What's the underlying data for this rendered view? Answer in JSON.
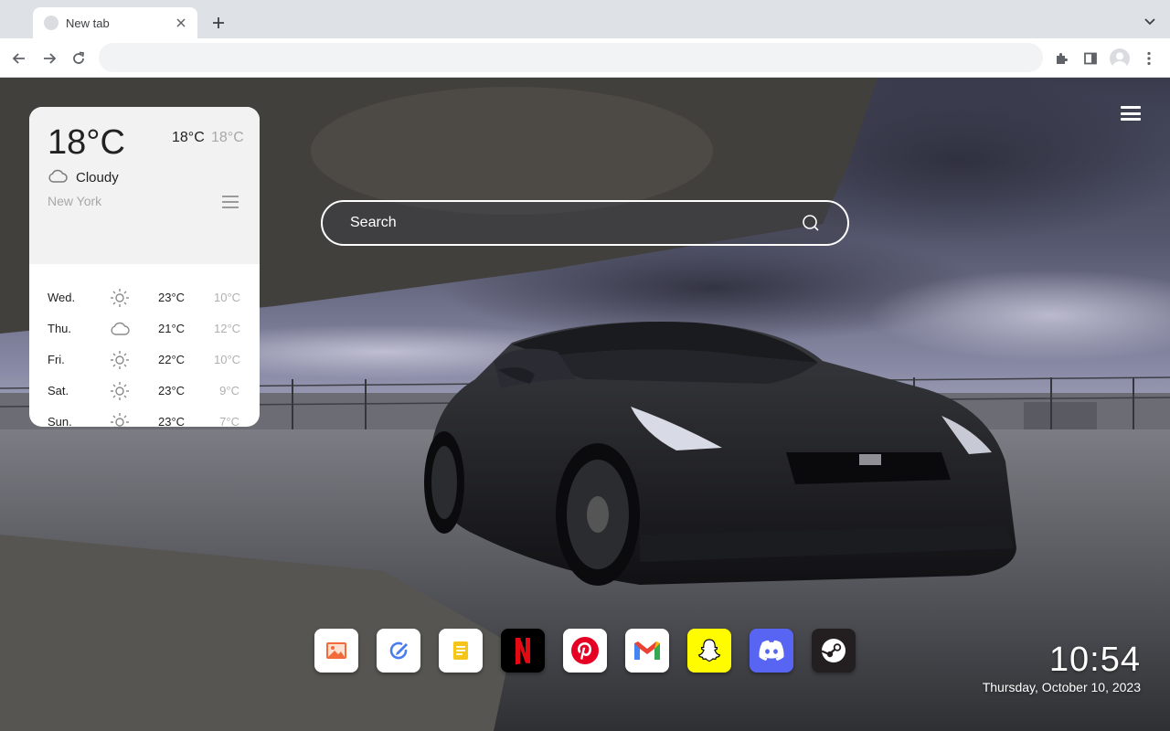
{
  "browser": {
    "tab": {
      "title": "New tab",
      "favicon": "blank-favicon"
    },
    "omnibox": {
      "value": "",
      "placeholder": ""
    },
    "icons": [
      "back-icon",
      "forward-icon",
      "reload-icon",
      "extensions-icon",
      "side-panel-icon",
      "profile-icon",
      "kebab-menu-icon",
      "new-tab-icon",
      "tab-search-icon"
    ]
  },
  "weather": {
    "temp": "18°C",
    "high": "18°C",
    "low": "18°C",
    "condition": "Cloudy",
    "condition_icon": "cloud-icon",
    "city": "New York",
    "forecast": [
      {
        "day": "Wed.",
        "icon": "sun-icon",
        "high": "23°C",
        "low": "10°C"
      },
      {
        "day": "Thu.",
        "icon": "cloud-icon",
        "high": "21°C",
        "low": "12°C"
      },
      {
        "day": "Fri.",
        "icon": "sun-icon",
        "high": "22°C",
        "low": "10°C"
      },
      {
        "day": "Sat.",
        "icon": "sun-icon",
        "high": "23°C",
        "low": "9°C"
      },
      {
        "day": "Sun.",
        "icon": "sun-icon",
        "high": "23°C",
        "low": "7°C"
      }
    ]
  },
  "search": {
    "placeholder": "Search"
  },
  "dock": [
    {
      "name": "photos",
      "icon": "image-icon",
      "bg": "#ffffff"
    },
    {
      "name": "edit",
      "icon": "pen-circle-icon",
      "bg": "#ffffff"
    },
    {
      "name": "notes",
      "icon": "notes-icon",
      "bg": "#ffffff"
    },
    {
      "name": "netflix",
      "icon": "netflix-icon",
      "bg": "#000000"
    },
    {
      "name": "pinterest",
      "icon": "pinterest-icon",
      "bg": "#ffffff"
    },
    {
      "name": "gmail",
      "icon": "gmail-icon",
      "bg": "#ffffff"
    },
    {
      "name": "snapchat",
      "icon": "snapchat-icon",
      "bg": "#fffc00"
    },
    {
      "name": "discord",
      "icon": "discord-icon",
      "bg": "#5865f2"
    },
    {
      "name": "steam",
      "icon": "steam-icon",
      "bg": "#231f20"
    }
  ],
  "clock": {
    "time": "10:54",
    "date": "Thursday, October 10, 2023"
  },
  "colors": {
    "chrome_bg": "#dee1e6",
    "toolbar_bg": "#ffffff",
    "omnibox_bg": "#f1f3f4",
    "accent_red": "#e50914"
  }
}
